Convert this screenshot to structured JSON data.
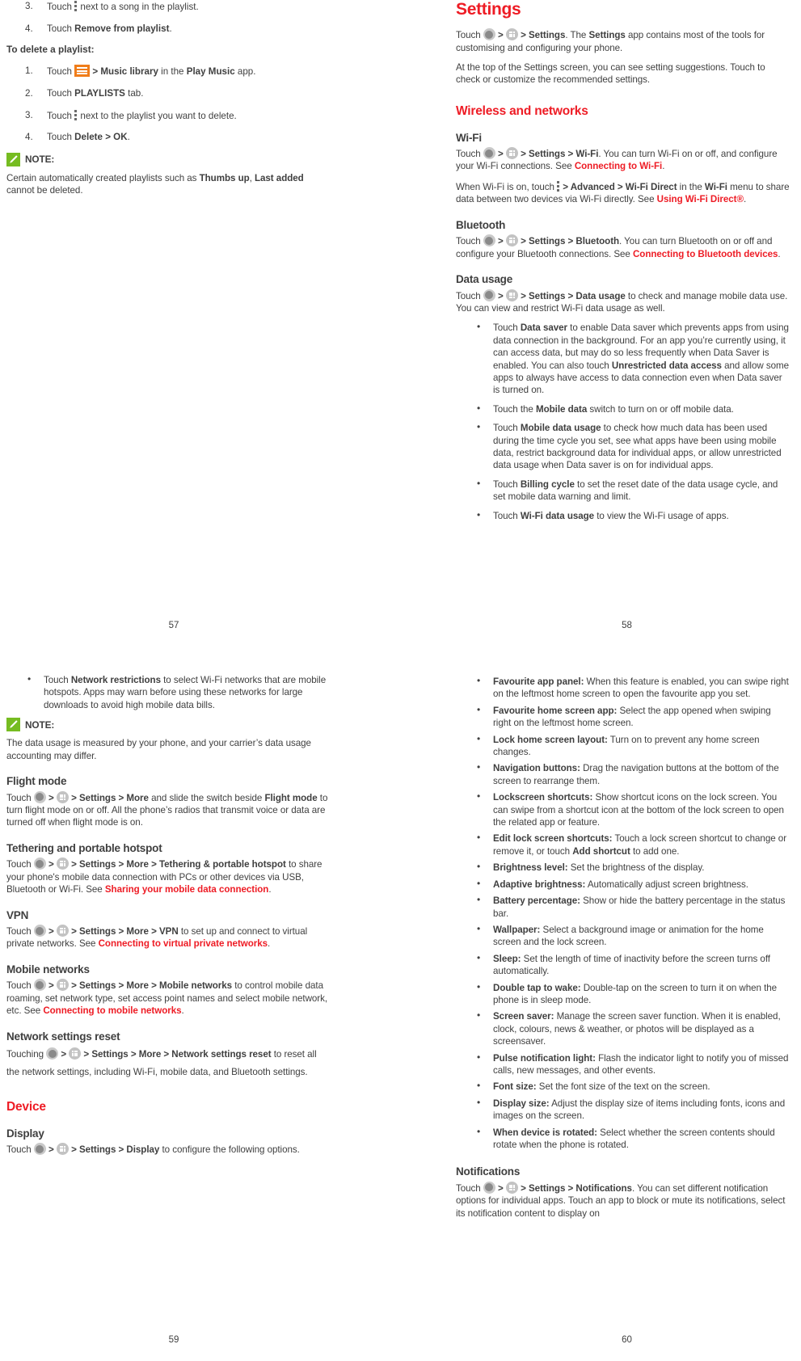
{
  "document": {
    "type": "phone-user-manual-spread",
    "accent_red": "#ee1c25",
    "accent_green": "#76bc21",
    "accent_orange": "#f07d1a",
    "text_color": "#3f3f3f"
  },
  "page57": {
    "number": "57",
    "steps_top": [
      {
        "num": "3.",
        "pre": "Touch ",
        "icon": "overflow-dots-icon",
        "post": " next to a song in the playlist."
      },
      {
        "num": "4.",
        "pre": "Touch ",
        "bold": "Remove from playlist",
        "post": "."
      }
    ],
    "subhead": "To delete a playlist:",
    "steps_delete": [
      {
        "num": "1.",
        "pre": "Touch ",
        "icon": "hamburger-menu-icon",
        "bold": " > Music library",
        "mid": " in the ",
        "bold2": "Play Music",
        "post": " app."
      },
      {
        "num": "2.",
        "pre": "Touch ",
        "bold": "PLAYLISTS",
        "post": " tab."
      },
      {
        "num": "3.",
        "pre": "Touch ",
        "icon": "overflow-dots-icon",
        "post": " next to the playlist you want to delete."
      },
      {
        "num": "4.",
        "pre": "Touch ",
        "bold": "Delete > OK",
        "post": "."
      }
    ],
    "note": {
      "label": "NOTE:",
      "text_pre": "Certain automatically created playlists such as ",
      "bold1": "Thumbs up",
      "text_mid": ", ",
      "bold2": "Last added",
      "text_post": " cannot be deleted."
    }
  },
  "page58": {
    "number": "58",
    "title": "Settings",
    "intro1_pre": "Touch ",
    "intro1_mid": " > ",
    "intro1_bold": " > Settings",
    "intro1_post": ". The ",
    "intro1_bold2": "Settings",
    "intro1_post2": " app contains most of the tools for customising and configuring your phone.",
    "intro2": "At the top of the Settings screen, you can see setting suggestions. Touch to check or customize the recommended settings.",
    "section_wireless": "Wireless and networks",
    "wifi": {
      "heading": "Wi-Fi",
      "p1_pre": "Touch ",
      "p1_bold": " > Settings > Wi-Fi",
      "p1_post": ". You can turn Wi-Fi on or off, and configure your Wi-Fi connections. See ",
      "p1_link": "Connecting to Wi-Fi",
      "p1_end": ".",
      "p2_pre": "When Wi-Fi is on, touch ",
      "p2_bold": " > Advanced > Wi-Fi Direct",
      "p2_mid": " in the ",
      "p2_bold2": "Wi-Fi",
      "p2_post": " menu to share data between two devices via Wi-Fi directly. See ",
      "p2_link": "Using Wi-Fi Direct®",
      "p2_end": "."
    },
    "bluetooth": {
      "heading": "Bluetooth",
      "p1_pre": "Touch ",
      "p1_bold": " > Settings > Bluetooth",
      "p1_post": ". You can turn Bluetooth on or off and configure your Bluetooth connections. See ",
      "p1_link": "Connecting to Bluetooth devices",
      "p1_end": "."
    },
    "data_usage": {
      "heading": "Data usage",
      "p1_pre": "Touch ",
      "p1_bold": " > Settings > Data usage",
      "p1_post": " to check and manage mobile data use. You can view and restrict Wi-Fi data usage as well.",
      "bullets": [
        {
          "pre": "Touch ",
          "bold": "Data saver",
          "mid": " to enable Data saver which prevents apps from using data connection in the background. For an app you’re currently using, it can access data, but may do so less frequently when Data Saver is enabled. You can also touch ",
          "bold2": "Unrestricted data access",
          "post": " and allow some apps to always have access to data connection even when Data saver is turned on."
        },
        {
          "pre": "Touch the ",
          "bold": "Mobile data",
          "mid": " switch to turn on or off mobile data."
        },
        {
          "pre": "Touch ",
          "bold": "Mobile data usage",
          "mid": " to check how much data has been used during the time cycle you set, see what apps have been using mobile data, restrict background data for individual apps, or allow unrestricted data usage when Data saver is on for individual apps."
        },
        {
          "pre": "Touch ",
          "bold": "Billing cycle",
          "mid": " to set the reset date of the data usage cycle, and set mobile data warning and limit."
        },
        {
          "pre": "Touch ",
          "bold": "Wi-Fi data usage",
          "mid": " to view the Wi-Fi usage of apps."
        }
      ]
    }
  },
  "page59": {
    "number": "59",
    "bullet_network_restrictions": {
      "pre": "Touch ",
      "bold": "Network restrictions",
      "mid": " to select Wi-Fi networks that are mobile hotspots. Apps may warn before using these networks for large downloads to avoid high mobile data bills."
    },
    "note": {
      "label": "NOTE:",
      "text": "The data usage is measured by your phone, and your carrier’s data usage accounting may differ."
    },
    "flight_mode": {
      "heading": "Flight mode",
      "p1_pre": "Touch ",
      "p1_bold": " > Settings > More",
      "p1_mid": " and slide the switch beside ",
      "p1_bold2": "Flight mode",
      "p1_post": " to turn flight mode on or off. All the phone’s radios that transmit voice or data are turned off when flight mode is on."
    },
    "tethering": {
      "heading": "Tethering and portable hotspot",
      "p1_pre": "Touch ",
      "p1_bold": " > Settings > More > Tethering & portable hotspot",
      "p1_post": " to share your phone's mobile data connection with PCs or other devices via USB, Bluetooth or Wi-Fi. See ",
      "p1_link": "Sharing your mobile data connection",
      "p1_end": "."
    },
    "vpn": {
      "heading": "VPN",
      "p1_pre": "Touch ",
      "p1_bold": " > Settings > More > VPN",
      "p1_post": " to set up and connect to virtual private networks. See ",
      "p1_link": "Connecting to virtual private networks",
      "p1_end": "."
    },
    "mobile_networks": {
      "heading": "Mobile networks",
      "p1_pre": "Touch ",
      "p1_bold": " > Settings > More > Mobile networks",
      "p1_post": " to control mobile data roaming, set network type, set access point names and select mobile network, etc. See ",
      "p1_link": "Connecting to mobile networks",
      "p1_end": "."
    },
    "network_reset": {
      "heading": "Network settings reset",
      "p1_pre": "Touching ",
      "p1_bold": " > Settings > More > Network settings reset",
      "p1_post": " to reset all the network settings, including Wi-Fi, mobile data, and Bluetooth settings."
    },
    "section_device": "Device",
    "display": {
      "heading": "Display",
      "p1_pre": "Touch ",
      "p1_bold": " > Settings > Display",
      "p1_post": " to configure the following options."
    }
  },
  "page60": {
    "number": "60",
    "bullets": [
      {
        "bold": "Favourite app panel:",
        "text": " When this feature is enabled, you can swipe right on the leftmost home screen to open the favourite app you set."
      },
      {
        "bold": "Favourite home screen app:",
        "text": " Select the app opened when swiping right on the leftmost home screen."
      },
      {
        "bold": "Lock home screen layout:",
        "text": " Turn on to prevent any home screen changes."
      },
      {
        "bold": "Navigation buttons:",
        "text": " Drag the navigation buttons at the bottom of the screen to rearrange them."
      },
      {
        "bold": "Lockscreen shortcuts:",
        "text": " Show shortcut icons on the lock screen. You can swipe from a shortcut icon at the bottom of the lock screen to open the related app or feature."
      },
      {
        "bold": "Edit lock screen shortcuts:",
        "text": " Touch a lock screen shortcut to change or remove it, or touch ",
        "bold2": "Add shortcut",
        "text2": " to add one."
      },
      {
        "bold": "Brightness level:",
        "text": " Set the brightness of the display."
      },
      {
        "bold": "Adaptive brightness:",
        "text": " Automatically adjust screen brightness."
      },
      {
        "bold": "Battery percentage:",
        "text": " Show or hide the battery percentage in the status bar."
      },
      {
        "bold": "Wallpaper:",
        "text": " Select a background image or animation for the home screen and the lock screen."
      },
      {
        "bold": "Sleep:",
        "text": " Set the length of time of inactivity before the screen turns off automatically."
      },
      {
        "bold": "Double tap to wake:",
        "text": " Double-tap on the screen to turn it on when the phone is in sleep mode."
      },
      {
        "bold": "Screen saver:",
        "text": " Manage the screen saver function. When it is enabled, clock, colours, news & weather, or photos will be displayed as a screensaver."
      },
      {
        "bold": "Pulse notification light:",
        "text": " Flash the indicator light to notify you of missed calls, new messages, and other events."
      },
      {
        "bold": "Font size:",
        "text": " Set the font size of the text on the screen."
      },
      {
        "bold": "Display size:",
        "text": " Adjust the display size of items including fonts, icons and images on the screen."
      },
      {
        "bold": "When device is rotated:",
        "text": " Select whether the screen contents should rotate when the phone is rotated."
      }
    ],
    "notifications": {
      "heading": "Notifications",
      "p1_pre": "Touch ",
      "p1_bold": " > Settings > Notifications",
      "p1_post": ". You can set different notification options for individual apps. Touch an app to block or mute its notifications, select its notification content to display on"
    }
  }
}
